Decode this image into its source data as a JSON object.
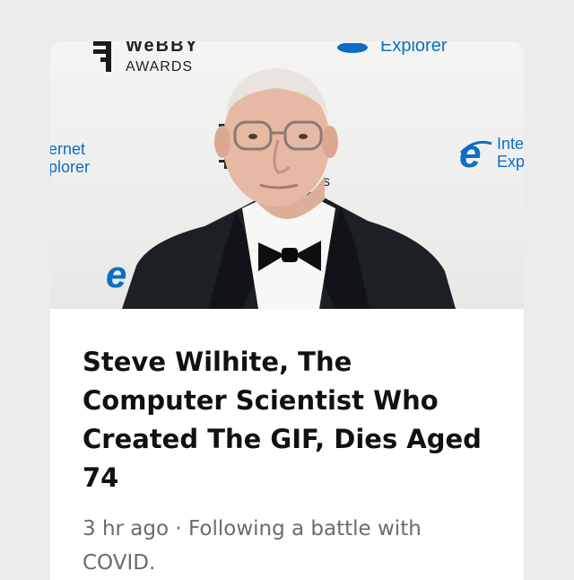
{
  "photo": {
    "alt": "",
    "backdrop": {
      "webby_name": "WeBBY",
      "webby_awards": "AWARDS",
      "explorer_top": "Explorer",
      "ernet": "ernet",
      "plorer": "plorer",
      "inte": "Inte",
      "exp": "Exp",
      "s": "s"
    },
    "accent_color": "#0b6dc4"
  },
  "article": {
    "headline": "Steve Wilhite, The Computer Scientist Who Created The GIF, Dies Aged 74",
    "meta": "3 hr ago · Following a battle with COVID."
  }
}
